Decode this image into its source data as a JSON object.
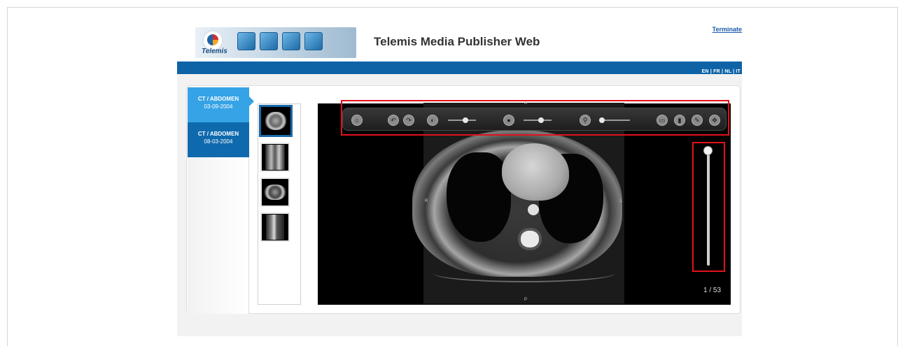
{
  "header": {
    "logo_text": "Telemis",
    "title": "Telemis Media Publisher Web",
    "terminate": "Terminate",
    "languages": "EN | FR | NL | IT"
  },
  "studies": [
    {
      "modality": "CT / ABDOMEN",
      "date": "03-09-2004"
    },
    {
      "modality": "CT / ABDOMEN",
      "date": "08-03-2004"
    }
  ],
  "viewer": {
    "orientation": {
      "top": "A",
      "bottom": "P",
      "left": "R",
      "right": "L"
    },
    "slice_counter": "1 / 53",
    "slice_position_fraction": 0.0
  },
  "toolbar": {
    "buttons": [
      "home-icon",
      "undo-icon",
      "redo-icon",
      "contrast-icon",
      "brightness-icon",
      "zoom-icon",
      "layout-icon",
      "delete-icon",
      "settings-icon",
      "tools-icon"
    ]
  },
  "colors": {
    "brand_blue": "#0e63a7",
    "active_tab": "#36a3e6",
    "highlight_red": "#e3121b"
  }
}
